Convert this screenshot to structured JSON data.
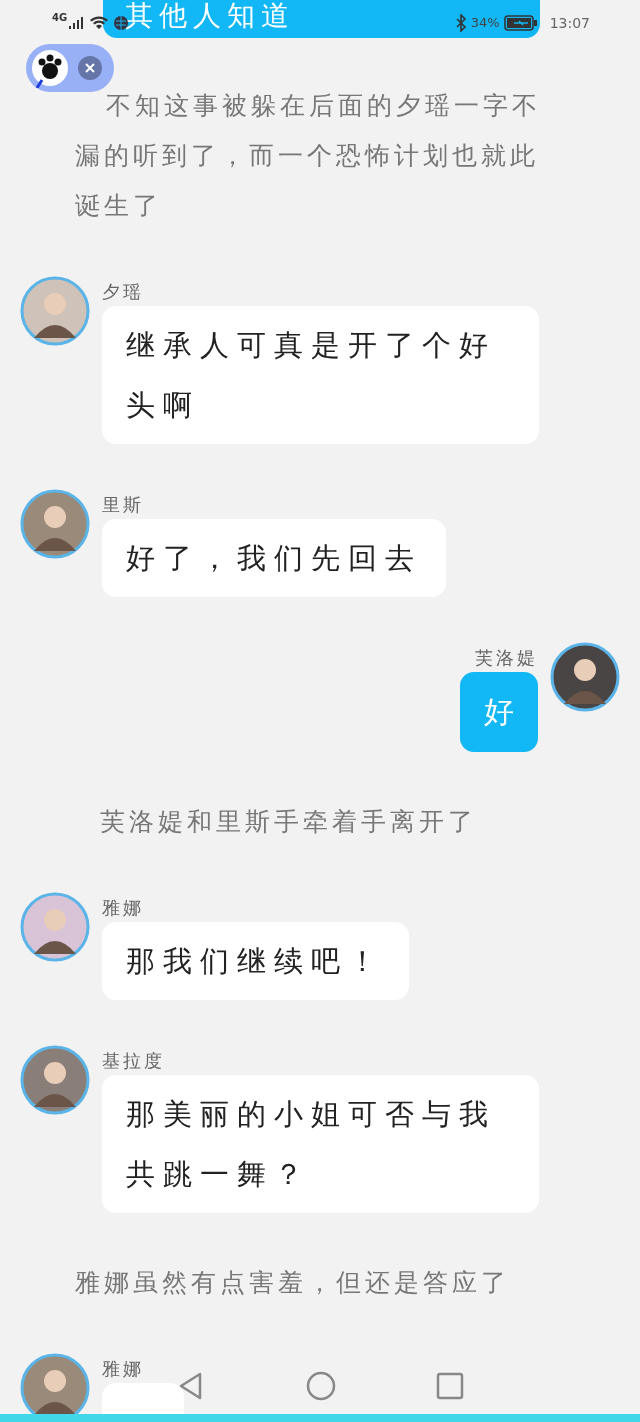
{
  "status_bar": {
    "network": "4G",
    "battery": "34%",
    "time": "13:07"
  },
  "messages": [
    {
      "kind": "outgoing_cut",
      "text": "其他人知道"
    },
    {
      "kind": "narration",
      "text": "不知这事被躲在后面的夕瑶一字不漏的听到了，而一个恐怖计划也就此诞生了"
    },
    {
      "kind": "incoming",
      "sender": "夕瑶",
      "text": "继承人可真是开了个好头啊"
    },
    {
      "kind": "incoming",
      "sender": "里斯",
      "text": "好了，我们先回去"
    },
    {
      "kind": "outgoing",
      "sender": "芙洛媞",
      "text": "好"
    },
    {
      "kind": "narration_indent",
      "text": "芙洛媞和里斯手牵着手离开了"
    },
    {
      "kind": "incoming",
      "sender": "雅娜",
      "text": "那我们继续吧！"
    },
    {
      "kind": "incoming",
      "sender": "基拉度",
      "text": "那美丽的小姐可否与我共跳一舞？"
    },
    {
      "kind": "narration",
      "text": "雅娜虽然有点害羞，但还是答应了"
    },
    {
      "kind": "incoming",
      "sender": "雅娜"
    }
  ]
}
